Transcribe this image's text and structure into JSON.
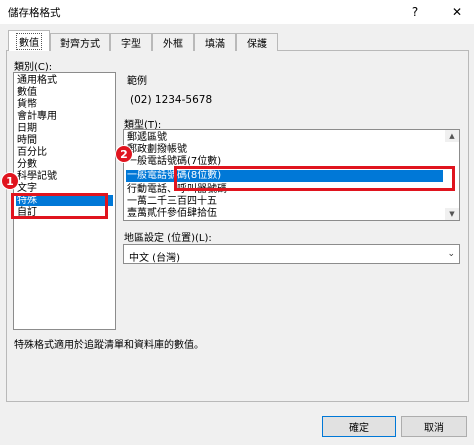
{
  "window": {
    "title": "儲存格格式",
    "help_glyph": "?",
    "close_glyph": "✕"
  },
  "tabs": [
    {
      "label": "數值"
    },
    {
      "label": "對齊方式"
    },
    {
      "label": "字型"
    },
    {
      "label": "外框"
    },
    {
      "label": "填滿"
    },
    {
      "label": "保護"
    }
  ],
  "category": {
    "label": "類別(C):",
    "items": [
      "通用格式",
      "數值",
      "貨幣",
      "會計專用",
      "日期",
      "時間",
      "百分比",
      "分數",
      "科學記號",
      "文字",
      "特殊",
      "自訂"
    ],
    "selected": "特殊"
  },
  "sample": {
    "label": "範例",
    "value": "(02) 1234-5678"
  },
  "type": {
    "label": "類型(T):",
    "items": [
      "郵遞區號",
      "郵政劃撥帳號",
      "一般電話號碼(7位數)",
      "一般電話號碼(8位數)",
      "行動電話、呼叫器號碼",
      "一萬二千三百四十五",
      "壹萬貳仟參佰肆拾伍"
    ],
    "selected": "一般電話號碼(8位數)"
  },
  "locale": {
    "label": "地區設定 (位置)(L):",
    "value": "中文 (台灣)"
  },
  "description": "特殊格式適用於追蹤清單和資料庫的數值。",
  "annotations": {
    "badge1": "1",
    "badge2": "2",
    "color": "#e0141e"
  },
  "buttons": {
    "ok": "確定",
    "cancel": "取消"
  },
  "colors": {
    "selection": "#0078d7",
    "annotation": "#e0141e"
  }
}
